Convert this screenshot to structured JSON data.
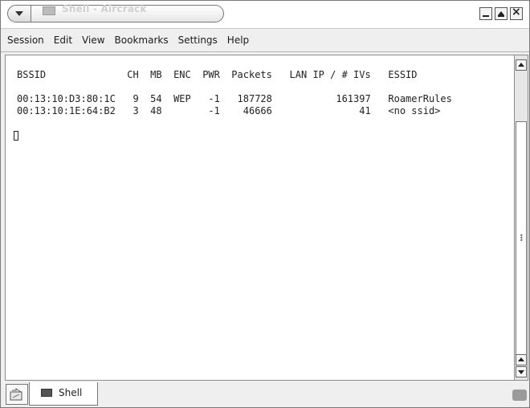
{
  "window": {
    "title": "Shell - Aircrack"
  },
  "menubar": {
    "items": [
      "Session",
      "Edit",
      "View",
      "Bookmarks",
      "Settings",
      "Help"
    ]
  },
  "terminal": {
    "lines": [
      "BSSID              CH  MB  ENC  PWR  Packets   LAN IP / # IVs   ESSID",
      "",
      "00:13:10:D3:80:1C   9  54  WEP   -1   187728           161397   RoamerRules",
      "00:13:10:1E:64:B2   3  48        -1    46666               41   <no ssid>"
    ]
  },
  "tabbar": {
    "tabs": [
      {
        "label": "Shell"
      }
    ]
  },
  "icons": {
    "window_menu": "chevron-down-icon",
    "minimize": "minimize-icon",
    "maximize": "maximize-icon",
    "close": "close-icon",
    "new_tab": "new-tab-icon",
    "tab": "terminal-icon"
  }
}
